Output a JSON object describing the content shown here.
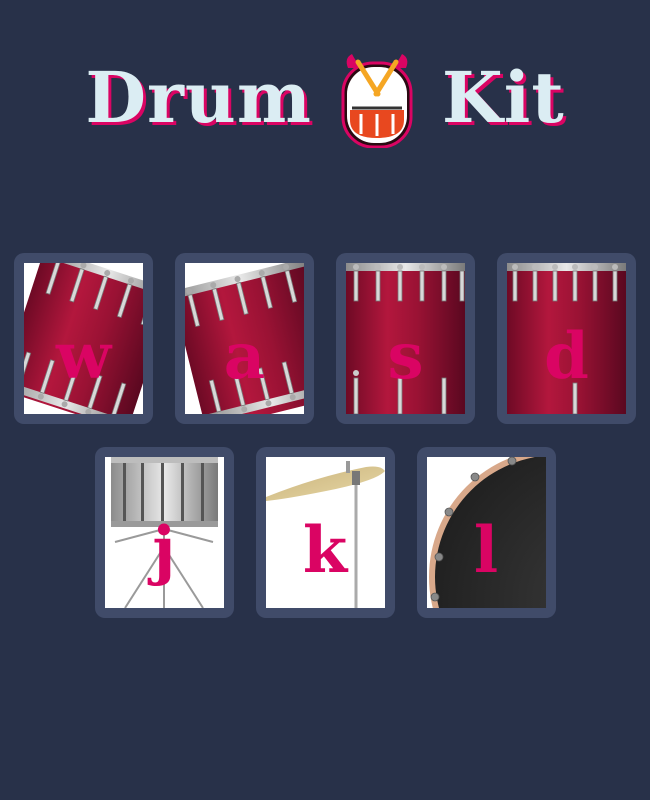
{
  "title": {
    "word_left": "Drum",
    "word_right": "Kit",
    "logo_icon": "drum-icon"
  },
  "colors": {
    "background": "#283149",
    "key_frame": "#404b69",
    "letter": "#da0463",
    "title_text": "#dbedf3"
  },
  "keys": [
    {
      "letter": "w",
      "icon": "tom-drum-icon"
    },
    {
      "letter": "a",
      "icon": "tom-drum-icon"
    },
    {
      "letter": "s",
      "icon": "snare-drum-icon"
    },
    {
      "letter": "d",
      "icon": "snare-drum-icon"
    },
    {
      "letter": "j",
      "icon": "hi-hat-stand-icon"
    },
    {
      "letter": "k",
      "icon": "cymbal-icon"
    },
    {
      "letter": "l",
      "icon": "bass-drum-icon"
    }
  ]
}
